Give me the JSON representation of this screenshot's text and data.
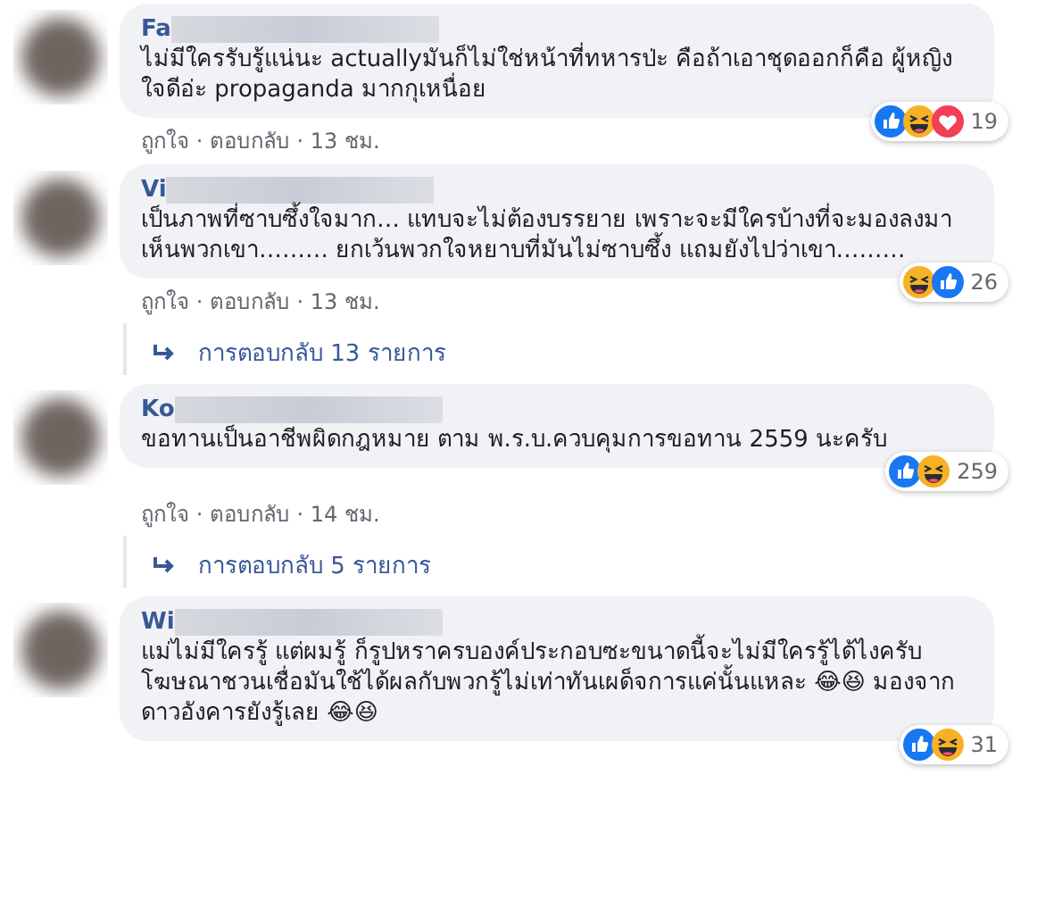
{
  "comments": [
    {
      "name": "Fa",
      "text": "ไม่มีใครรับรู้แน่นะ actuallyมันก็ไม่ใช่หน้าที่ทหารป่ะ คือถ้าเอาชุดออกก็คือ ผู้หญิงใจดีอ่ะ propaganda มากกุเหนื่อย",
      "reactions": [
        {
          "kind": "like"
        },
        {
          "kind": "haha"
        },
        {
          "kind": "love"
        }
      ],
      "reaction_count": "19",
      "meta": "ถูกใจ · ตอบกลับ · 13 ชม."
    },
    {
      "name": "Vi",
      "text": "เป็นภาพที่ซาบซึ้งใจมาก… แทบจะไม่ต้องบรรยาย เพราะจะมีใครบ้างที่จะมองลงมาเห็นพวกเขา……… ยกเว้นพวกใจหยาบที่มันไม่ซาบซึ้ง แถมยังไปว่าเขา………",
      "reactions": [
        {
          "kind": "haha"
        },
        {
          "kind": "like"
        }
      ],
      "reaction_count": "26",
      "meta": "ถูกใจ · ตอบกลับ · 13 ชม.",
      "replies": "การตอบกลับ 13 รายการ"
    },
    {
      "name": "Ko",
      "text": "ขอทานเป็นอาชีพผิดกฎหมาย ตาม พ.ร.บ.ควบคุมการขอทาน 2559 นะครับ",
      "reactions": [
        {
          "kind": "like"
        },
        {
          "kind": "haha"
        }
      ],
      "reaction_count": "259",
      "meta": "ถูกใจ · ตอบกลับ · 14 ชม.",
      "replies": "การตอบกลับ 5 รายการ"
    },
    {
      "name": "Wi",
      "text": "แม่ไม่มีใครรู้ แต่ผมรู้ ก็รูปหราครบองค์ประกอบซะขนาดนี้จะไม่มีใครรู้ได้ไงครับ โฆษณาชวนเชื่อมันใช้ได้ผลกับพวกรู้ไม่เท่าทันเผด็จการแค่นั้นแหละ 😂😆 มองจากดาวอังคารยังรู้เลย 😂😆",
      "reactions": [
        {
          "kind": "like"
        },
        {
          "kind": "haha"
        }
      ],
      "reaction_count": "31"
    }
  ]
}
